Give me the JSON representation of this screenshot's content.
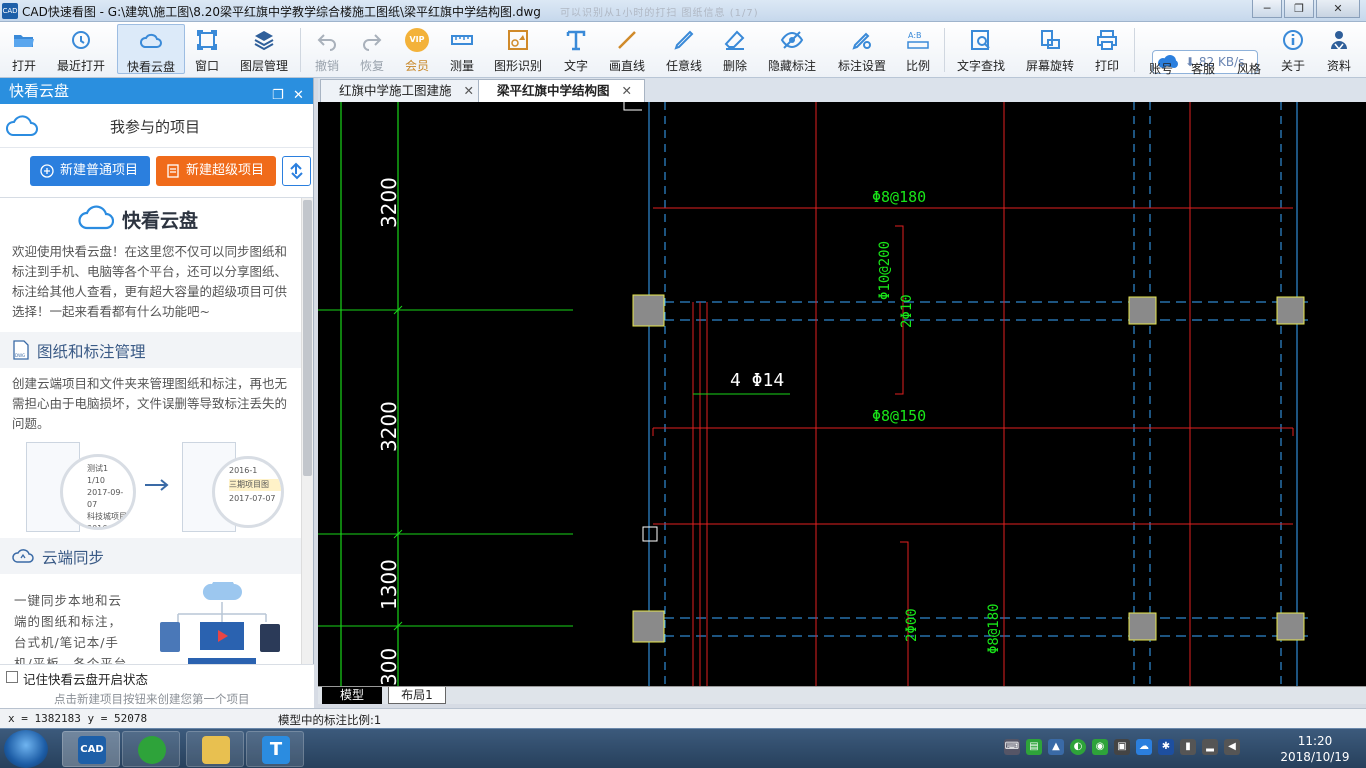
{
  "window": {
    "title": "CAD快速看图 - G:\\建筑\\施工图\\8.20梁平红旗中学教学综合楼施工图纸\\梁平红旗中学结构图.dwg",
    "extra": "可以识别从1小时的打扫  图纸信息 (1/7)",
    "logo_text": "CAD",
    "minimize": "─",
    "restore": "❐",
    "close": "✕"
  },
  "toolbar": {
    "items": [
      {
        "label": "打开",
        "icon": "folder-open-icon"
      },
      {
        "label": "最近打开",
        "icon": "recent-clock-icon"
      },
      {
        "label": "快看云盘",
        "icon": "cloud-icon"
      },
      {
        "label": "窗口",
        "icon": "window-icon"
      },
      {
        "label": "图层管理",
        "icon": "layers-icon"
      },
      {
        "label": "撤销",
        "icon": "undo-icon"
      },
      {
        "label": "恢复",
        "icon": "redo-icon"
      },
      {
        "label": "会员",
        "icon": "vip-icon"
      },
      {
        "label": "测量",
        "icon": "ruler-icon"
      },
      {
        "label": "图形识别",
        "icon": "shape-recognize-icon"
      },
      {
        "label": "文字",
        "icon": "text-icon"
      },
      {
        "label": "画直线",
        "icon": "line-icon"
      },
      {
        "label": "任意线",
        "icon": "freehand-icon"
      },
      {
        "label": "删除",
        "icon": "eraser-icon"
      },
      {
        "label": "隐藏标注",
        "icon": "eye-hide-icon"
      },
      {
        "label": "标注设置",
        "icon": "settings-icon"
      },
      {
        "label": "比例",
        "icon": "scale-icon"
      },
      {
        "label": "文字查找",
        "icon": "text-search-icon"
      },
      {
        "label": "屏幕旋转",
        "icon": "rotate-icon"
      },
      {
        "label": "打印",
        "icon": "printer-icon"
      },
      {
        "label": "账号",
        "icon": "account-icon"
      },
      {
        "label": "客服",
        "icon": "headset-icon"
      },
      {
        "label": "风格",
        "icon": "theme-icon"
      },
      {
        "label": "关于",
        "icon": "info-icon"
      },
      {
        "label": "资料",
        "icon": "resource-icon"
      }
    ],
    "speed": "82 KB/s",
    "speed_arrow": "⬇",
    "vip_text": "VIP"
  },
  "sidebar": {
    "header": "快看云盘",
    "restore_glyph": "❐",
    "close_glyph": "✕",
    "project_title": "我参与的项目",
    "btn_new_normal": "新建普通项目",
    "btn_new_super": "新建超级项目",
    "hero_title": "快看云盘",
    "intro": "欢迎使用快看云盘！在这里您不仅可以同步图纸和标注到手机、电脑等各个平台，还可以分享图纸、标注给其他人查看，更有超大容量的超级项目可供选择！一起来看看都有什么功能吧~",
    "sec1_title": "图纸和标注管理",
    "sec1_text": "创建云端项目和文件夹来管理图纸和标注，再也无需担心由于电脑损坏，文件误删等导致标注丢失的问题。",
    "sec2_title": "云端同步",
    "sec2_text": "一键同步本地和云端的图纸和标注，台式机/笔记本/手机/平板，各个平台图纸标",
    "illus": {
      "left_lines": [
        "测试1",
        "1/10",
        "2017-09-07",
        "科技城项目",
        "2016-07-1"
      ],
      "right_lines": [
        "2016-1",
        "三期项目图",
        "2017-07-07"
      ]
    },
    "remember_label": "记住快看云盘开启状态",
    "hint": "点击新建项目按钮来创建您第一个项目"
  },
  "tabs": [
    {
      "label": "红旗中学施工图建施",
      "active": false
    },
    {
      "label": "梁平红旗中学结构图",
      "active": true
    }
  ],
  "tab_close_glyph": "✕",
  "drawing": {
    "dims": [
      "3200",
      "3200",
      "1300",
      "300"
    ],
    "labels": [
      "Φ8@180",
      "Φ10@200",
      "2Φ10",
      "4 Φ14",
      "Φ8@150",
      "2Φ00",
      "Φ8@180"
    ]
  },
  "layout_tabs": [
    "模型",
    "布局1"
  ],
  "status": {
    "coord": "x = 1382183  y = 52078",
    "scale": "模型中的标注比例:1"
  },
  "taskbar": {
    "apps": [
      {
        "name": "cad-viewer",
        "text": "CAD"
      },
      {
        "name": "browser",
        "text": ""
      },
      {
        "name": "explorer",
        "text": ""
      },
      {
        "name": "text-tool",
        "text": "T"
      }
    ],
    "tray": [
      "⌨",
      "▤",
      "▲",
      "◐",
      "◉",
      "▣",
      "☁",
      "✱",
      "▮",
      "▂",
      "◀"
    ],
    "time": "11:20",
    "date": "2018/10/19"
  }
}
